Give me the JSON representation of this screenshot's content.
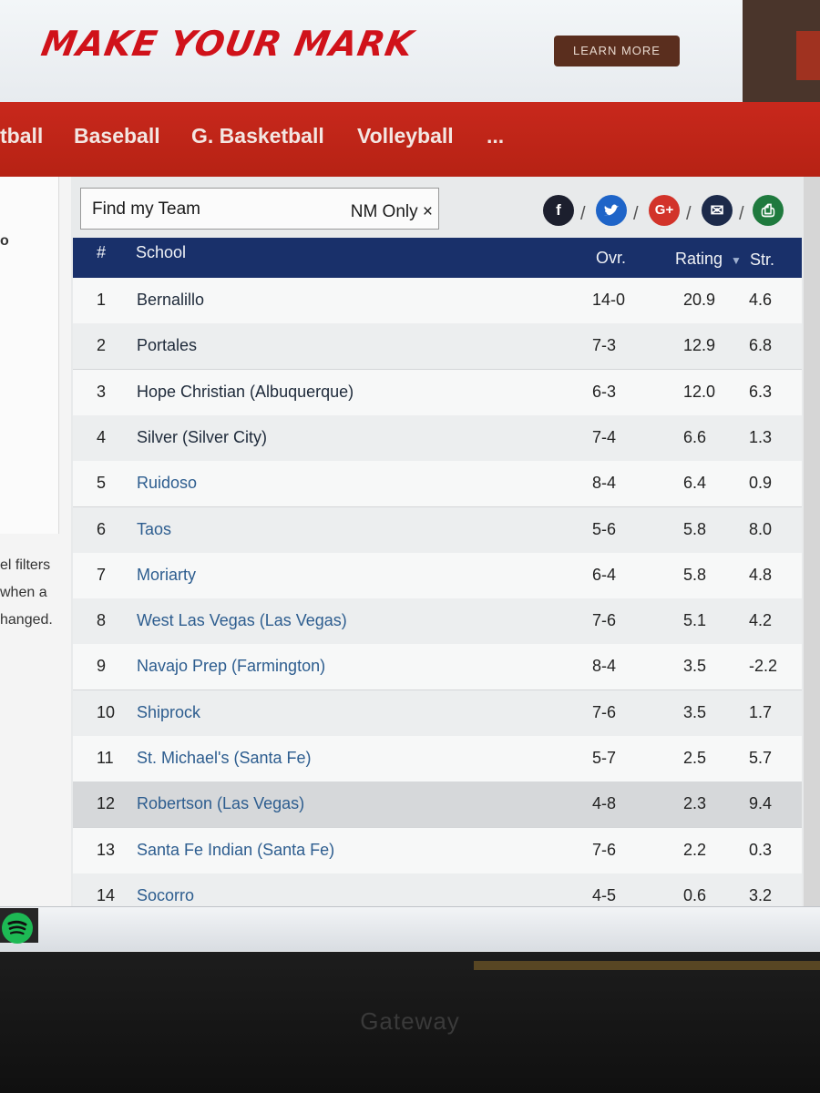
{
  "ad": {
    "slogan": "MAKE YOUR MARK",
    "button": "LEARN MORE"
  },
  "nav": {
    "items": [
      "tball",
      "Baseball",
      "G. Basketball",
      "Volleyball",
      "..."
    ]
  },
  "sidebar": {
    "top_fragment": "o",
    "lines": [
      "el filters",
      "when a",
      "hanged."
    ]
  },
  "search": {
    "placeholder": "Find my Team",
    "filter": "NM Only ×"
  },
  "share": {
    "facebook": "f",
    "twitter": "t",
    "google": "G+",
    "email": "✉",
    "print": "⎙",
    "separator": "/"
  },
  "table": {
    "headers": {
      "rank": "#",
      "school": "School",
      "overall": "Ovr.",
      "rating": "Rating",
      "strength": "Str."
    },
    "rows": [
      {
        "rank": "1",
        "school": "Bernalillo",
        "overall": "14-0",
        "rating": "20.9",
        "strength": "4.6"
      },
      {
        "rank": "2",
        "school": "Portales",
        "overall": "7-3",
        "rating": "12.9",
        "strength": "6.8"
      },
      {
        "rank": "3",
        "school": "Hope Christian (Albuquerque)",
        "overall": "6-3",
        "rating": "12.0",
        "strength": "6.3"
      },
      {
        "rank": "4",
        "school": "Silver (Silver City)",
        "overall": "7-4",
        "rating": "6.6",
        "strength": "1.3"
      },
      {
        "rank": "5",
        "school": "Ruidoso",
        "overall": "8-4",
        "rating": "6.4",
        "strength": "0.9"
      },
      {
        "rank": "6",
        "school": "Taos",
        "overall": "5-6",
        "rating": "5.8",
        "strength": "8.0"
      },
      {
        "rank": "7",
        "school": "Moriarty",
        "overall": "6-4",
        "rating": "5.8",
        "strength": "4.8"
      },
      {
        "rank": "8",
        "school": "West Las Vegas (Las Vegas)",
        "overall": "7-6",
        "rating": "5.1",
        "strength": "4.2"
      },
      {
        "rank": "9",
        "school": "Navajo Prep (Farmington)",
        "overall": "8-4",
        "rating": "3.5",
        "strength": "-2.2"
      },
      {
        "rank": "10",
        "school": "Shiprock",
        "overall": "7-6",
        "rating": "3.5",
        "strength": "1.7"
      },
      {
        "rank": "11",
        "school": "St. Michael's (Santa Fe)",
        "overall": "5-7",
        "rating": "2.5",
        "strength": "5.7"
      },
      {
        "rank": "12",
        "school": "Robertson (Las Vegas)",
        "overall": "4-8",
        "rating": "2.3",
        "strength": "9.4"
      },
      {
        "rank": "13",
        "school": "Santa Fe Indian (Santa Fe)",
        "overall": "7-6",
        "rating": "2.2",
        "strength": "0.3"
      },
      {
        "rank": "14",
        "school": "Socorro",
        "overall": "4-5",
        "rating": "0.6",
        "strength": "3.2"
      }
    ]
  },
  "colors": {
    "nav_red": "#c8281c",
    "header_navy": "#19306a",
    "link_blue": "#2d5d8f",
    "facebook": "#1c1f2e",
    "twitter": "#1e64c8",
    "google": "#d2332a",
    "email": "#1c2a4a",
    "print": "#1f7a3e"
  },
  "monitor": {
    "brand": "Gateway"
  }
}
